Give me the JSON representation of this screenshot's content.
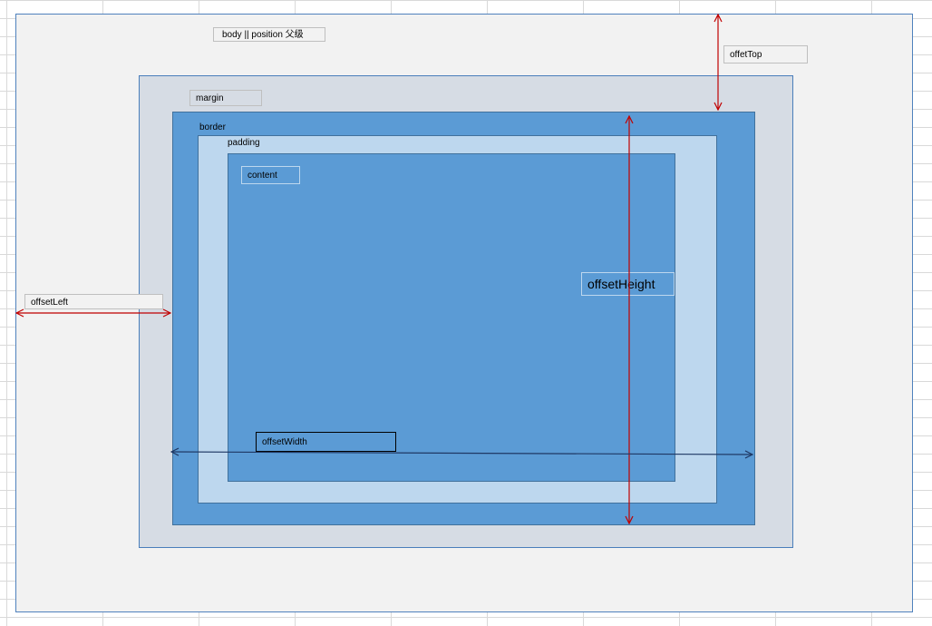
{
  "labels": {
    "body": "body || position 父级",
    "offsettop": "offetTop",
    "margin": "margin",
    "border": "border",
    "padding": "padding",
    "content": "content",
    "offsetleft": "offsetLeft",
    "offsetheight": "offsetHeight",
    "offsetwidth": "offsetWidth"
  },
  "colors": {
    "body_fill": "#f2f2f2",
    "margin_fill": "#d6dce4",
    "border_fill": "#5b9bd5",
    "padding_fill": "#bdd7ee",
    "content_fill": "#5b9bd5",
    "red_arrow": "#c00000",
    "dark_arrow": "#1f3864"
  }
}
